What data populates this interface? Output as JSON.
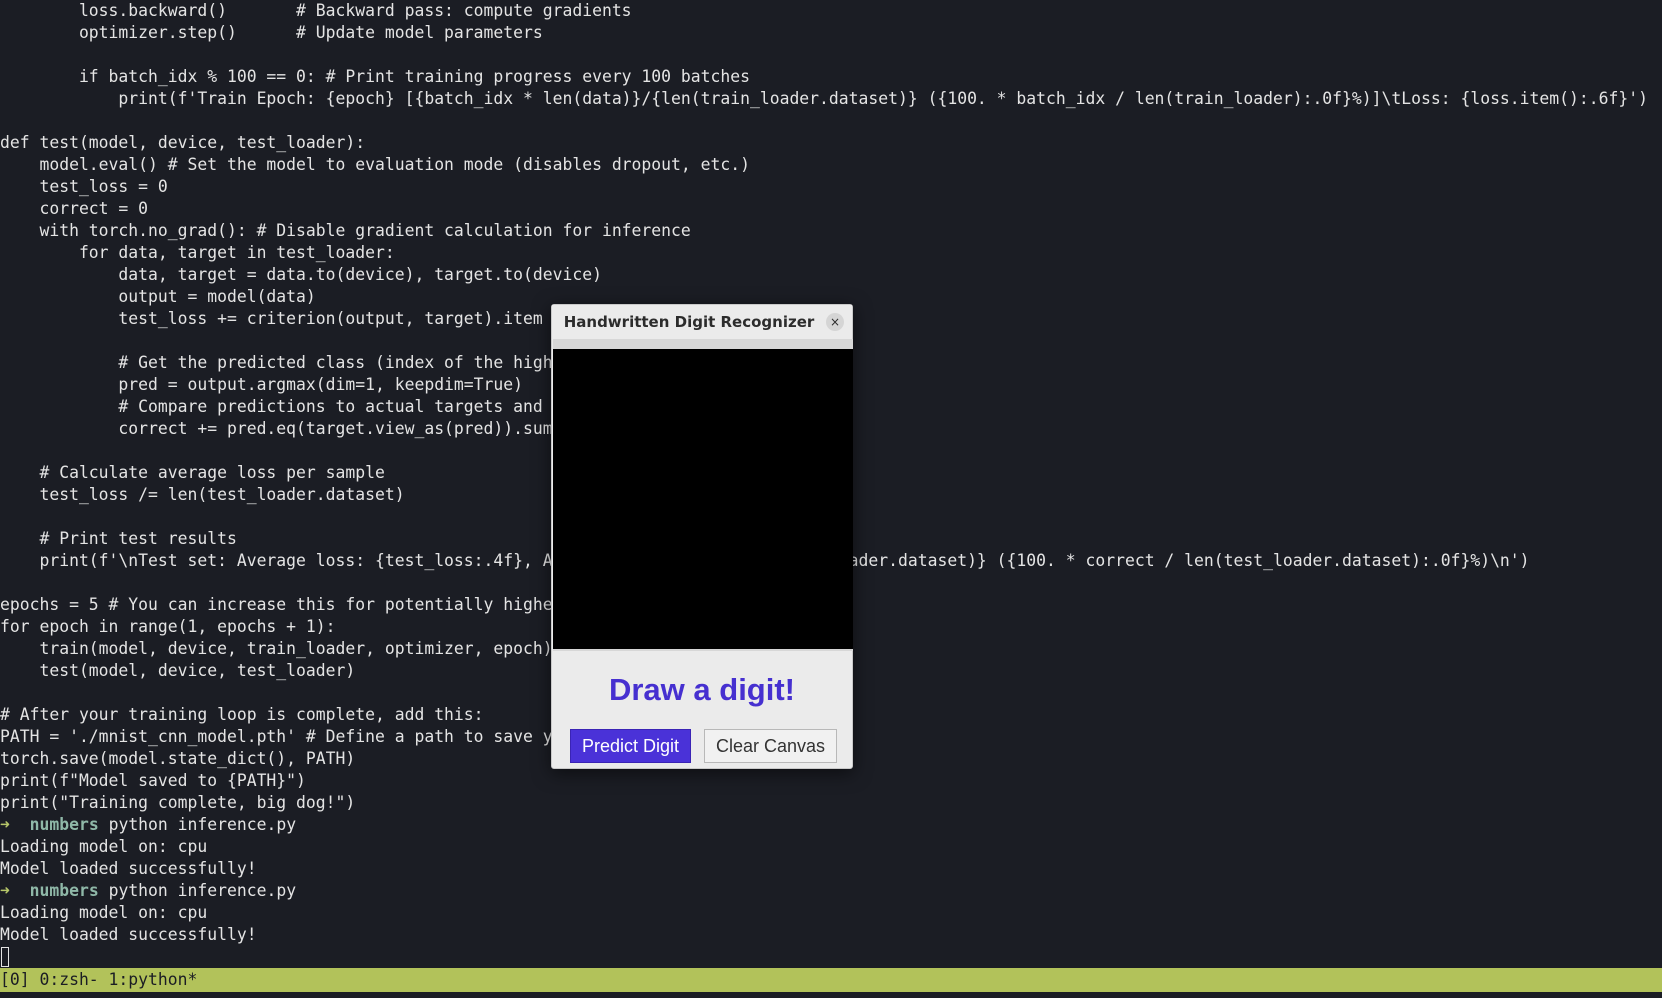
{
  "terminal": {
    "lines": [
      "        loss.backward()       # Backward pass: compute gradients",
      "        optimizer.step()      # Update model parameters",
      "",
      "        if batch_idx % 100 == 0: # Print training progress every 100 batches",
      "            print(f'Train Epoch: {epoch} [{batch_idx * len(data)}/{len(train_loader.dataset)} ({100. * batch_idx / len(train_loader):.0f}%)]\\tLoss: {loss.item():.6f}')",
      "",
      "def test(model, device, test_loader):",
      "    model.eval() # Set the model to evaluation mode (disables dropout, etc.)",
      "    test_loss = 0",
      "    correct = 0",
      "    with torch.no_grad(): # Disable gradient calculation for inference",
      "        for data, target in test_loader:",
      "            data, target = data.to(device), target.to(device)",
      "            output = model(data)",
      "            test_loss += criterion(output, target).item",
      "",
      "            # Get the predicted class (index of the high",
      "            pred = output.argmax(dim=1, keepdim=True)",
      "            # Compare predictions to actual targets and",
      "            correct += pred.eq(target.view_as(pred)).sum",
      "",
      "    # Calculate average loss per sample",
      "    test_loss /= len(test_loader.dataset)",
      "",
      "    # Print test results",
      "    print(f'\\nTest set: Average loss: {test_loss:.4f}, A                             oader.dataset)} ({100. * correct / len(test_loader.dataset):.0f}%)\\n')",
      "",
      "epochs = 5 # You can increase this for potentially highe",
      "for epoch in range(1, epochs + 1):",
      "    train(model, device, train_loader, optimizer, epoch)",
      "    test(model, device, test_loader)",
      "",
      "# After your training loop is complete, add this:",
      "PATH = './mnist_cnn_model.pth' # Define a path to save y",
      "torch.save(model.state_dict(), PATH)",
      "print(f\"Model saved to {PATH}\")",
      "print(\"Training complete, big dog!\")",
      {
        "prompt": {
          "arrow": "➜",
          "dir": "numbers",
          "cmd": "python inference.py"
        }
      },
      "Loading model on: cpu",
      "Model loaded successfully!",
      {
        "prompt": {
          "arrow": "➜",
          "dir": "numbers",
          "cmd": "python inference.py"
        }
      },
      "Loading model on: cpu",
      "Model loaded successfully!"
    ]
  },
  "status_bar": {
    "text": "[0] 0:zsh- 1:python*"
  },
  "dialog": {
    "title": "Handwritten Digit Recognizer",
    "close_icon": "×",
    "prompt_label": "Draw a digit!",
    "predict_label": "Predict Digit",
    "clear_label": "Clear Canvas"
  },
  "colors": {
    "terminal_bg": "#1b1d24",
    "terminal_fg": "#e4e4e4",
    "status_bar_bg": "#b2c25a",
    "prompt_arrow": "#b7c76a",
    "prompt_dir": "#8fb8a8",
    "dialog_accent": "#4630d0",
    "predict_button_bg": "#4a32d8",
    "canvas_bg": "#000000"
  }
}
